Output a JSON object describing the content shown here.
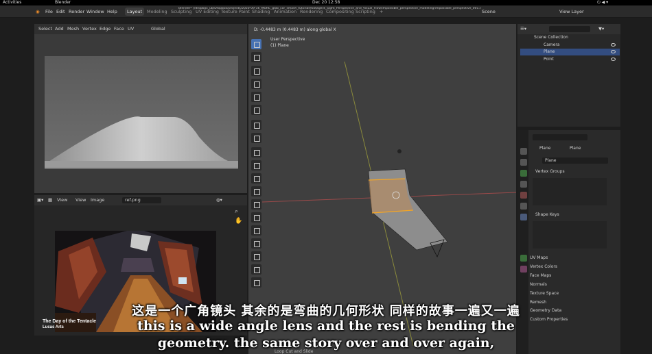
{
  "topbar": {
    "activities": "Activities",
    "app": "Blender",
    "clock": "Dec 20  12:58"
  },
  "window": {
    "path": "Blender* [/dropbox_ub/Dropbox/projects/2020-09-16_MORE_glob_car_smash_tutorial/footage/4_Sight_Perspective_and_Visual_Flow/impossible_perspective_modeling/impossible_perspective_001.blend]"
  },
  "menu": [
    "File",
    "Edit",
    "Render",
    "Window",
    "Help"
  ],
  "workspaces": [
    "Layout",
    "Modeling",
    "Sculpting",
    "UV Editing",
    "Texture Paint",
    "Shading",
    "Animation",
    "Rendering",
    "Compositing",
    "Scripting"
  ],
  "scene": {
    "label": "Scene",
    "view_layer": "View Layer"
  },
  "uv_header": {
    "items": [
      "Select",
      "Add",
      "Mesh",
      "Vertex",
      "Edge",
      "Face",
      "UV"
    ],
    "orientation": "Global"
  },
  "viewport": {
    "status": "D: -0.4483 m (0.4483 m) along global X",
    "mode": "User Perspective",
    "object": "(1) Plane"
  },
  "image_editor": {
    "view": "View",
    "view2": "View",
    "image": "Image",
    "file": "ref.png"
  },
  "reference": {
    "title": "The Day of the Tentacle",
    "studio": "Lucas Arts"
  },
  "outliner": {
    "root": "Scene Collection",
    "items": [
      "Camera",
      "Plane",
      "Point"
    ]
  },
  "properties": {
    "object": "Plane",
    "mesh": "Plane",
    "data_name": "Plane",
    "sections": [
      "Vertex Groups",
      "Shape Keys",
      "UV Maps",
      "Vertex Colors",
      "Face Maps",
      "Normals",
      "Texture Space",
      "Remesh",
      "Geometry Data",
      "Custom Properties"
    ]
  },
  "footer": {
    "hint": "Loop Cut and Slide"
  },
  "subtitles": {
    "zh": "这是一个广角镜头 其余的是弯曲的几何形状  同样的故事一遍又一遍",
    "en1": "this is a wide angle lens and the rest is bending     the",
    "en2": "geometry. the same story over and over again,"
  },
  "colors": {
    "accent": "#4772b3",
    "selection": "#f5a623",
    "bg": "#1d1d1d"
  }
}
